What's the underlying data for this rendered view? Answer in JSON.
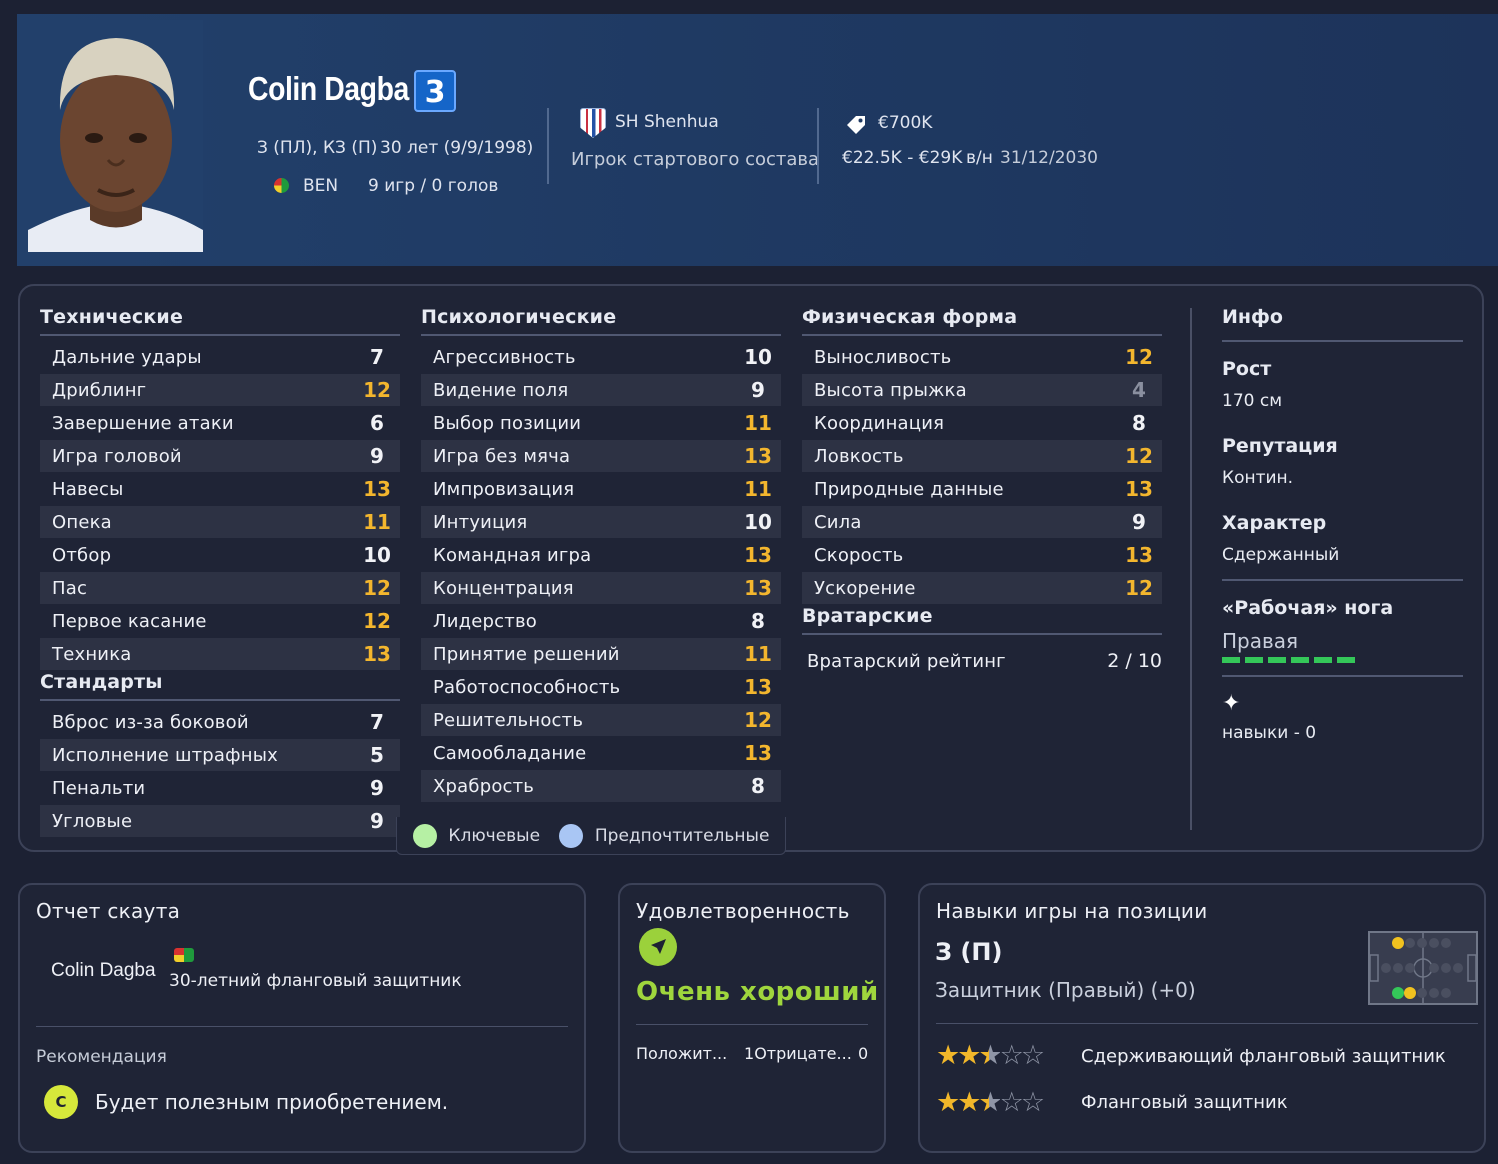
{
  "header": {
    "player_name": "Colin Dagba",
    "shirt_number": "3",
    "positions": "З (ПЛ), КЗ (П)",
    "age": "30 лет (9/9/1998)",
    "nationality": "BEN",
    "season_stats": "9 игр / 0 голов",
    "club": "SH Shenhua",
    "squad_status": "Игрок стартового состава",
    "value": "€700K",
    "wage": "€22.5K - €29K",
    "wage_period": "в/н",
    "contract_end": "31/12/2030"
  },
  "sections": {
    "technical": {
      "title": "Технические",
      "rows": [
        {
          "label": "Дальние удары",
          "value": "7",
          "tone": "normal"
        },
        {
          "label": "Дриблинг",
          "value": "12",
          "tone": "hi"
        },
        {
          "label": "Завершение атаки",
          "value": "6",
          "tone": "normal"
        },
        {
          "label": "Игра головой",
          "value": "9",
          "tone": "normal"
        },
        {
          "label": "Навесы",
          "value": "13",
          "tone": "hi"
        },
        {
          "label": "Опека",
          "value": "11",
          "tone": "hi"
        },
        {
          "label": "Отбор",
          "value": "10",
          "tone": "normal"
        },
        {
          "label": "Пас",
          "value": "12",
          "tone": "hi"
        },
        {
          "label": "Первое касание",
          "value": "12",
          "tone": "hi"
        },
        {
          "label": "Техника",
          "value": "13",
          "tone": "hi"
        }
      ]
    },
    "set_pieces": {
      "title": "Стандарты",
      "rows": [
        {
          "label": "Вброс из-за боковой",
          "value": "7",
          "tone": "normal"
        },
        {
          "label": "Исполнение штрафных",
          "value": "5",
          "tone": "normal"
        },
        {
          "label": "Пенальти",
          "value": "9",
          "tone": "normal"
        },
        {
          "label": "Угловые",
          "value": "9",
          "tone": "normal"
        }
      ]
    },
    "mental": {
      "title": "Психологические",
      "rows": [
        {
          "label": "Агрессивность",
          "value": "10",
          "tone": "normal"
        },
        {
          "label": "Видение поля",
          "value": "9",
          "tone": "normal"
        },
        {
          "label": "Выбор позиции",
          "value": "11",
          "tone": "hi"
        },
        {
          "label": "Игра без мяча",
          "value": "13",
          "tone": "hi"
        },
        {
          "label": "Импровизация",
          "value": "11",
          "tone": "hi"
        },
        {
          "label": "Интуиция",
          "value": "10",
          "tone": "normal"
        },
        {
          "label": "Командная игра",
          "value": "13",
          "tone": "hi"
        },
        {
          "label": "Концентрация",
          "value": "13",
          "tone": "hi"
        },
        {
          "label": "Лидерство",
          "value": "8",
          "tone": "normal"
        },
        {
          "label": "Принятие решений",
          "value": "11",
          "tone": "hi"
        },
        {
          "label": "Работоспособность",
          "value": "13",
          "tone": "hi"
        },
        {
          "label": "Решительность",
          "value": "12",
          "tone": "hi"
        },
        {
          "label": "Самообладание",
          "value": "13",
          "tone": "hi"
        },
        {
          "label": "Храбрость",
          "value": "8",
          "tone": "normal"
        }
      ]
    },
    "physical": {
      "title": "Физическая форма",
      "rows": [
        {
          "label": "Выносливость",
          "value": "12",
          "tone": "hi"
        },
        {
          "label": "Высота прыжка",
          "value": "4",
          "tone": "lo"
        },
        {
          "label": "Координация",
          "value": "8",
          "tone": "normal"
        },
        {
          "label": "Ловкость",
          "value": "12",
          "tone": "hi"
        },
        {
          "label": "Природные данные",
          "value": "13",
          "tone": "hi"
        },
        {
          "label": "Сила",
          "value": "9",
          "tone": "normal"
        },
        {
          "label": "Скорость",
          "value": "13",
          "tone": "hi"
        },
        {
          "label": "Ускорение",
          "value": "12",
          "tone": "hi"
        }
      ]
    },
    "goalkeeping": {
      "title": "Вратарские",
      "rating_label": "Вратарский рейтинг",
      "rating_value": "2 / 10"
    }
  },
  "legend": {
    "key": "Ключевые",
    "preferred": "Предпочтительные",
    "key_color": "#b6f0a4",
    "preferred_color": "#a9c6f4"
  },
  "info": {
    "title": "Инфо",
    "height_label": "Рост",
    "height_value": "170 см",
    "reputation_label": "Репутация",
    "reputation_value": "Контин.",
    "personality_label": "Характер",
    "personality_value": "Сдержанный",
    "foot_label": "«Рабочая» нога",
    "foot_value": "Правая",
    "traits": "навыки - 0"
  },
  "scout": {
    "title": "Отчет скаута",
    "player_name": "Colin Dagba",
    "description": "30-летний фланговый защитник",
    "recommendation_label": "Рекомендация",
    "grade": "C",
    "recommendation": "Будет полезным приобретением."
  },
  "satisfaction": {
    "title": "Удовлетворенность",
    "level": "Очень хороший",
    "positive_label": "Положит...",
    "positive_count": "1",
    "negative_label": "Отрицате...",
    "negative_count": "0"
  },
  "positions": {
    "title": "Навыки игры на позиции",
    "position": "З (П)",
    "role_detail": "Защитник (Правый) (+0)",
    "roles": [
      {
        "name": "Сдерживающий фланговый защитник",
        "stars": 2.5
      },
      {
        "name": "Фланговый защитник",
        "stars": 2.5
      }
    ]
  }
}
